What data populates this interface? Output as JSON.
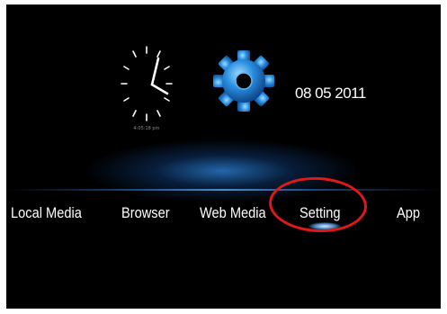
{
  "clock": {
    "time_text": "4:05:18 pm"
  },
  "date": "08 05 2011",
  "menu": {
    "items": [
      {
        "label": "Local Media"
      },
      {
        "label": "Browser"
      },
      {
        "label": "Web Media"
      },
      {
        "label": "Setting",
        "selected": true
      },
      {
        "label": "App"
      }
    ]
  },
  "colors": {
    "background": "#000000",
    "text": "#ffffff",
    "accent_blue": "#2a8ee0",
    "highlight_red": "#e01818"
  }
}
